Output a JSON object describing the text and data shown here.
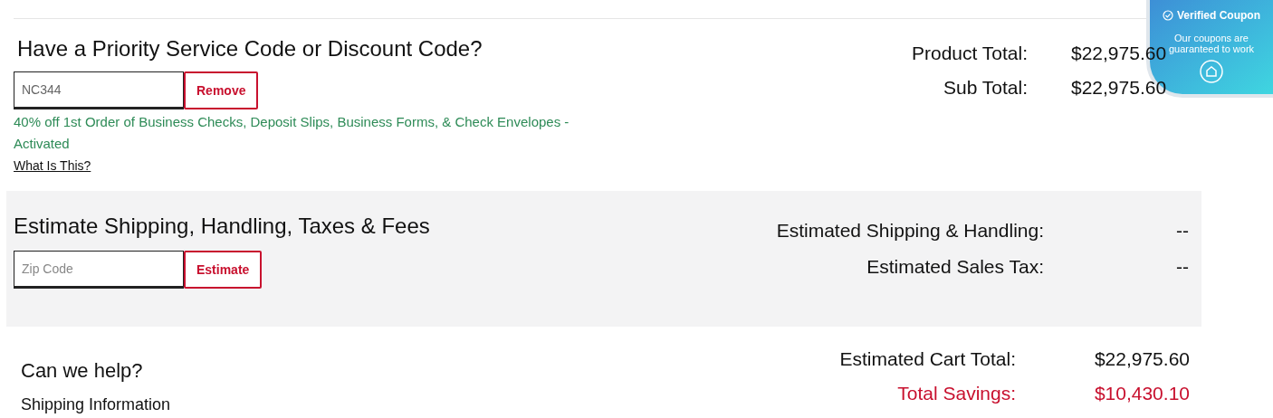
{
  "discount": {
    "title": "Have a Priority Service Code or Discount Code?",
    "code_field": {
      "value": "NC344"
    },
    "button": "Remove",
    "message": "40% off 1st Order of Business Checks, Deposit Slips, Business Forms, & Check Envelopes - Activated",
    "link": "What Is This?"
  },
  "totals": [
    {
      "label": "Product Total:",
      "value": "$22,975.60"
    },
    {
      "label": "Sub Total:",
      "value": "$22,975.60"
    }
  ],
  "shipping": {
    "title": "Estimate Shipping, Handling, Taxes & Fees",
    "zip_field": {
      "placeholder": "Zip Code"
    },
    "button": "Estimate",
    "lines": [
      {
        "label": "Estimated Shipping & Handling:",
        "value": "--"
      },
      {
        "label": "Estimated Sales Tax:",
        "value": "--"
      }
    ]
  },
  "help": {
    "title": "Can we help?",
    "links": [
      "Shipping Information"
    ]
  },
  "summary": [
    {
      "label": "Estimated Cart Total:",
      "value": "$22,975.60",
      "highlight": false
    },
    {
      "label": "Total Savings:",
      "value": "$10,430.10",
      "highlight": true
    }
  ],
  "coupon_badge": {
    "title": "Verified Coupon",
    "text": "Our coupons are guaranteed to work"
  }
}
